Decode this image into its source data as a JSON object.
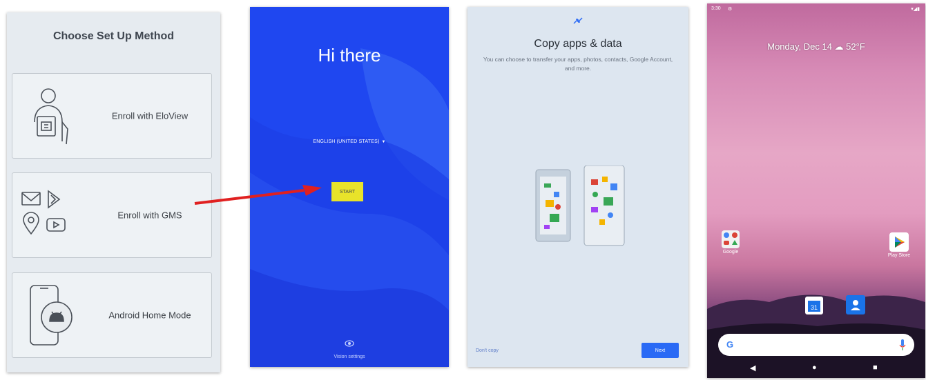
{
  "panel1": {
    "title": "Choose Set Up Method",
    "options": [
      {
        "label": "Enroll with EloView",
        "icon": "eloview-person-icon"
      },
      {
        "label": "Enroll with GMS",
        "icon": "gms-apps-icon"
      },
      {
        "label": "Android Home Mode",
        "icon": "android-device-icon"
      }
    ]
  },
  "panel2": {
    "greeting": "Hi there",
    "language": "ENGLISH (UNITED STATES)",
    "start_label": "START",
    "vision_label": "Vision settings",
    "bg_color": "#1f47f0",
    "start_color": "#e8e32a"
  },
  "panel3": {
    "title": "Copy apps & data",
    "subtitle": "You can choose to transfer your apps, photos, contacts, Google Account, and more.",
    "dont_copy_label": "Don't copy",
    "next_label": "Next",
    "accent": "#2a6af5"
  },
  "panel4": {
    "status_time": "3:30",
    "date_weather": "Monday, Dec 14 ☁ 52°F",
    "apps": [
      {
        "label": "Google",
        "icon": "google-folder-icon"
      },
      {
        "label": "Play Store",
        "icon": "play-store-icon"
      }
    ],
    "dock_icons": [
      "calendar-icon",
      "contacts-icon"
    ],
    "calendar_day": "31",
    "search_g": "G"
  },
  "arrow_color": "#e02020"
}
